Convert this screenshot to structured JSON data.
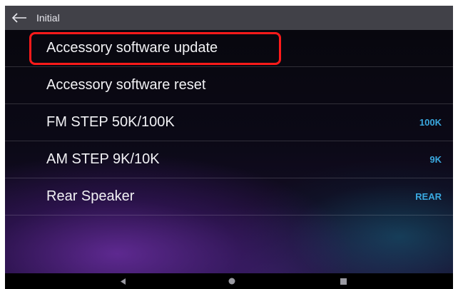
{
  "header": {
    "title": "Initial",
    "back_icon": "back-arrow-icon"
  },
  "menu": {
    "items": [
      {
        "label": "Accessory software update",
        "value": "",
        "highlighted": true
      },
      {
        "label": "Accessory software reset",
        "value": ""
      },
      {
        "label": "FM STEP 50K/100K",
        "value": "100K"
      },
      {
        "label": "AM STEP 9K/10K",
        "value": "9K"
      },
      {
        "label": "Rear Speaker",
        "value": "REAR"
      }
    ]
  },
  "navbar": {
    "icons": [
      "nav-back-icon",
      "nav-home-icon",
      "nav-recents-icon"
    ]
  },
  "colors": {
    "highlight": "#ff1a1a",
    "value_text": "#3aa9e0",
    "titlebar": "#414148"
  }
}
